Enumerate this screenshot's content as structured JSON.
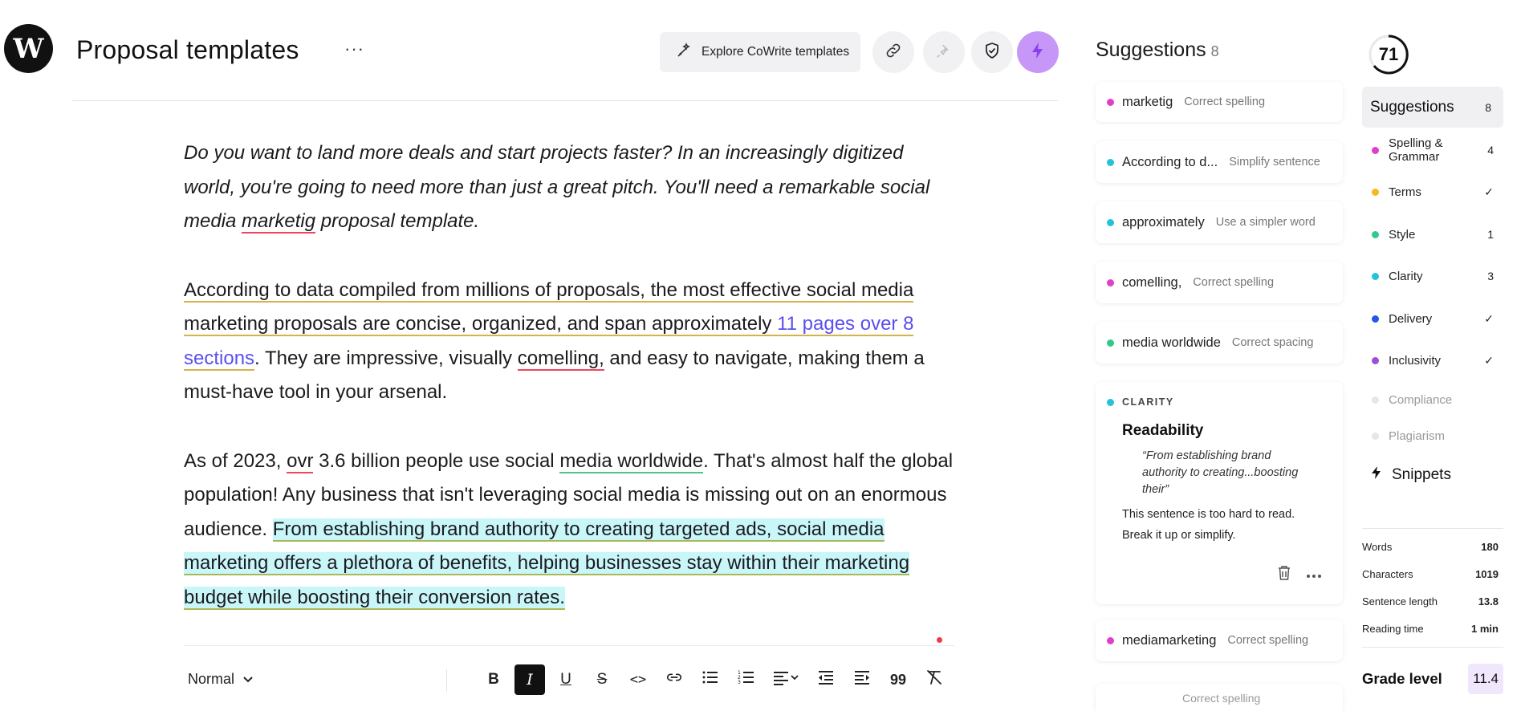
{
  "header": {
    "logo_letter": "W",
    "title": "Proposal templates",
    "more_label": "···",
    "explore_label": "Explore CoWrite templates",
    "icons": [
      "link-icon",
      "pin-icon",
      "shield-check-icon",
      "lightning-icon"
    ]
  },
  "editor": {
    "p1": {
      "a": "Do you want to land more deals and start projects faster? In an increasingly digitized world, you're going to need more than just a great pitch. You'll need a remarkable social media ",
      "b": "marketig",
      "c": " proposal template."
    },
    "p2": {
      "a": "According to data compiled from millions of proposals, the most effective social media marketing proposals are concise, organized, and span approximately ",
      "link": "11 pages over 8 sections",
      "c": ". They are impressive, visually ",
      "d": "comelling,",
      "e": " and easy to navigate, making them a must-have tool in your arsenal."
    },
    "p3": {
      "a": "As of 2023, ",
      "b": "ovr",
      "c": " 3.6 billion people use social ",
      "d": "media  worldwide",
      "e": ". That's almost half the global population! Any business that isn't leveraging social media is missing out on an enormous audience. ",
      "f": "From establishing brand authority to creating targeted ads, social media marketing offers a plethora of benefits, helping businesses stay within their marketing budget while boosting their conversion rates."
    }
  },
  "toolbar": {
    "style_value": "Normal",
    "buttons": [
      "bold",
      "italic",
      "underline",
      "strikethrough",
      "code",
      "link",
      "bulleted-list",
      "numbered-list",
      "align",
      "outdent",
      "indent",
      "quote",
      "clear-format"
    ],
    "bold_label": "B",
    "italic_label": "I",
    "underline_label": "U",
    "strike_label": "S",
    "code_label": "<>",
    "quote_label": "99"
  },
  "suggestions": {
    "title": "Suggestions",
    "count": "8",
    "items": [
      {
        "word": "marketig",
        "action": "Correct spelling",
        "color": "#e040c8"
      },
      {
        "word": "According to d...",
        "action": "Simplify sentence",
        "color": "#22c4d8"
      },
      {
        "word": "approximately",
        "action": "Use a simpler word",
        "color": "#22c4d8"
      },
      {
        "word": "comelling,",
        "action": "Correct spelling",
        "color": "#e040c8"
      },
      {
        "word": "media worldwide",
        "action": "Correct spacing",
        "color": "#34c98a"
      }
    ],
    "clarity_card": {
      "category": "CLARITY",
      "title": "Readability",
      "quote": "“From establishing brand authority to creating...boosting their”",
      "text": "This sentence is too hard to read. Break it up or simplify."
    },
    "after_items": [
      {
        "word": "mediamarketing",
        "action": "Correct spelling",
        "color": "#e040c8"
      }
    ],
    "partial_text": "Correct spelling"
  },
  "panel": {
    "score": "71",
    "active": {
      "label": "Suggestions",
      "count": "8"
    },
    "categories": [
      {
        "label": "Spelling & Grammar",
        "count": "4",
        "color": "#e040c8"
      },
      {
        "label": "Terms",
        "count": "✓",
        "color": "#f5b91a"
      },
      {
        "label": "Style",
        "count": "1",
        "color": "#34c98a"
      },
      {
        "label": "Clarity",
        "count": "3",
        "color": "#22c4d8"
      },
      {
        "label": "Delivery",
        "count": "✓",
        "color": "#2357e6"
      },
      {
        "label": "Inclusivity",
        "count": "✓",
        "color": "#9b4fd8"
      },
      {
        "label": "Compliance",
        "count": "",
        "color": "#e6e6ea"
      },
      {
        "label": "Plagiarism",
        "count": "",
        "color": "#e6e6ea"
      }
    ],
    "snippets_label": "Snippets",
    "stats": [
      {
        "label": "Words",
        "value": "180"
      },
      {
        "label": "Characters",
        "value": "1019"
      },
      {
        "label": "Sentence length",
        "value": "13.8"
      },
      {
        "label": "Reading time",
        "value": "1 min"
      }
    ],
    "grade_label": "Grade level",
    "grade_value": "11.4"
  }
}
